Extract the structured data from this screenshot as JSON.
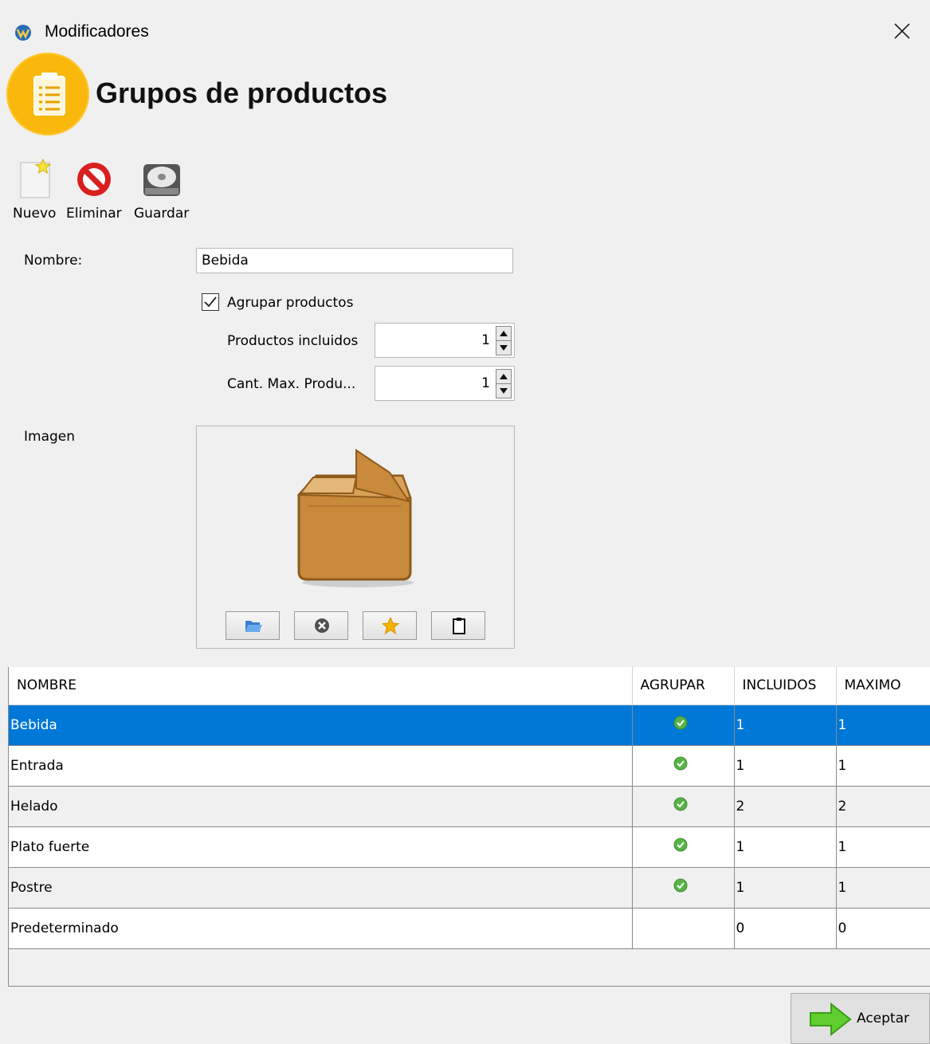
{
  "window": {
    "title": "Modificadores",
    "close_icon": "close-icon"
  },
  "header": {
    "title": "Grupos de productos",
    "icon": "clipboard-list-icon",
    "accent": "#f9b80b"
  },
  "toolbar": {
    "new_label": "Nuevo",
    "delete_label": "Eliminar",
    "save_label": "Guardar"
  },
  "form": {
    "name_label": "Nombre:",
    "name_value": "Bebida",
    "group_label": "Agrupar productos",
    "group_checked": true,
    "included_label": "Productos incluidos",
    "included_value": "1",
    "max_label": "Cant. Max. Produ...",
    "max_value": "1",
    "image_label": "Imagen"
  },
  "image_tools": [
    "folder-open-icon",
    "clear-icon",
    "star-icon",
    "clipboard-icon"
  ],
  "table": {
    "columns": [
      "NOMBRE",
      "AGRUPAR",
      "INCLUIDOS",
      "MAXIMO"
    ],
    "rows": [
      {
        "name": "Bebida",
        "group": true,
        "included": "1",
        "max": "1"
      },
      {
        "name": "Entrada",
        "group": true,
        "included": "1",
        "max": "1"
      },
      {
        "name": "Helado",
        "group": true,
        "included": "2",
        "max": "2"
      },
      {
        "name": "Plato fuerte",
        "group": true,
        "included": "1",
        "max": "1"
      },
      {
        "name": "Postre",
        "group": true,
        "included": "1",
        "max": "1"
      },
      {
        "name": "Predeterminado",
        "group": false,
        "included": "0",
        "max": "0"
      }
    ],
    "selected_row": 0,
    "selection_color": "#0078d7"
  },
  "footer": {
    "accept_label": "Aceptar"
  }
}
